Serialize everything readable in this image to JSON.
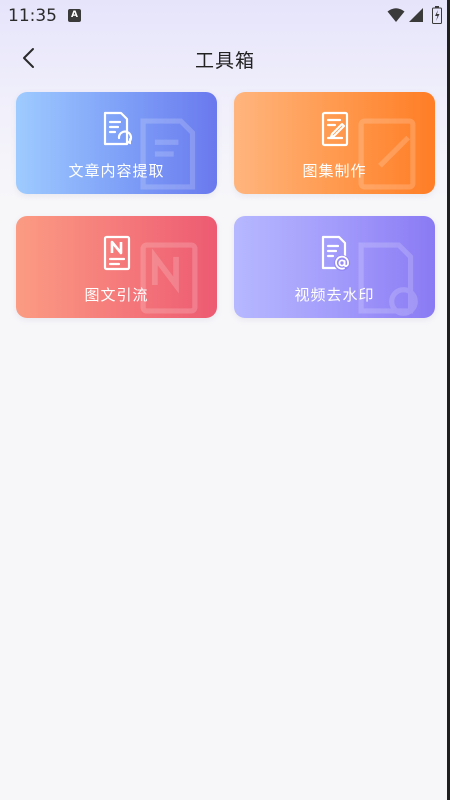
{
  "status_bar": {
    "time": "11:35",
    "notification_icon_label": "A",
    "icons": [
      "wifi-icon",
      "signal-icon",
      "battery-icon"
    ]
  },
  "header": {
    "title": "工具箱",
    "back_icon": "chevron-left-icon"
  },
  "tools": [
    {
      "label": "文章内容提取",
      "icon": "document-extract-icon",
      "gradient": [
        "#9ecbff",
        "#6a79ee"
      ]
    },
    {
      "label": "图集制作",
      "icon": "document-edit-icon",
      "gradient": [
        "#ffb57e",
        "#ff7d25"
      ]
    },
    {
      "label": "图文引流",
      "icon": "note-n-icon",
      "gradient": [
        "#fb9c83",
        "#ed5a72"
      ]
    },
    {
      "label": "视频去水印",
      "icon": "document-at-icon",
      "gradient": [
        "#b6b8ff",
        "#8a7af4"
      ]
    }
  ]
}
